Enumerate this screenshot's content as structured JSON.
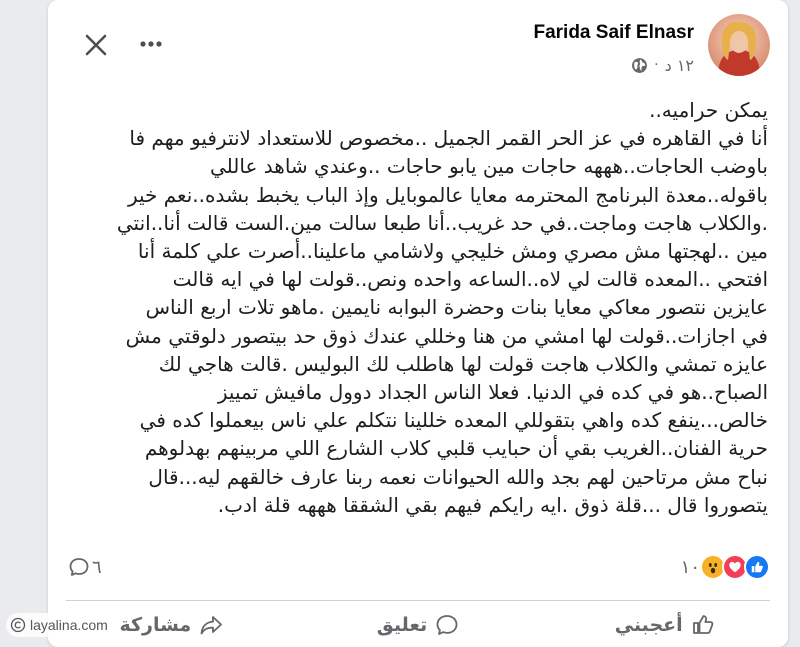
{
  "post": {
    "author_name": "Farida Saif Elnasr",
    "timestamp": "١٢ د",
    "privacy_icon": "globe-icon",
    "body_lines": [
      "يمكن حراميه..",
      "أنا في القاهره في عز الحر القمر الجميل ..مخصوص للاستعداد لانترفيو مهم فا",
      "باوضب الحاجات..هههه حاجات مين يابو حاجات ..وعندي شاهد عاللي",
      "باقوله..معدة البرنامج المحترمه معايا عالموبايل وإذ الباب يخبط بشده..نعم خير",
      ".والكلاب هاجت وماجت..في حد غريب..أنا طبعا سالت مين.الست قالت أنا..انتي",
      "مين ..لهجتها مش مصري ومش خليجي ولاشامي ماعلينا..أصرت علي كلمة أنا",
      "افتحي ..المعده قالت لي لاه..الساعه واحده ونص..قولت لها في ايه قالت",
      "عايزين نتصور معاكي معايا بنات وحضرة البوابه نايمين .ماهو تلات اربع الناس",
      "في اجازات..قولت لها امشي من هنا وخللي عندك ذوق حد بيتصور دلوقتي مش",
      "عايزه تمشي والكلاب هاجت قولت لها هاطلب لك البوليس .قالت هاجي لك",
      "الصباح..هو في كده في الدنيا. فعلا الناس الجداد دوول مافيش تمييز",
      "خالص...ينفع كده واهي بتقوللي المعده خللينا نتكلم علي ناس بيعملوا كده في",
      "حرية الفنان..الغريب بقي أن حبايب قلبي كلاب الشارع اللي مربينهم بهدلوهم",
      "نباح مش مرتاحين لهم بجد والله الحيوانات نعمه ربنا عارف خالقهم ليه...قال",
      "يتصوروا قال ...قلة ذوق .ايه رايكم فيهم بقي الشققا هههه قلة ادب."
    ]
  },
  "stats": {
    "reactions_count": "١٠",
    "comments_count": "٦",
    "reaction_icons": [
      "like-reaction-icon",
      "love-reaction-icon",
      "wow-reaction-icon"
    ]
  },
  "actions": {
    "like_label": "أعجبني",
    "comment_label": "تعليق",
    "share_label": "مشاركة"
  },
  "watermark": {
    "text": "layalina.com"
  },
  "colors": {
    "background": "#e9ebee",
    "card": "#ffffff",
    "text": "#1c1e21",
    "secondary_text": "#65676b",
    "like_blue": "#1877f2",
    "love_red": "#f33e58",
    "wow_yellow": "#f7b125"
  }
}
